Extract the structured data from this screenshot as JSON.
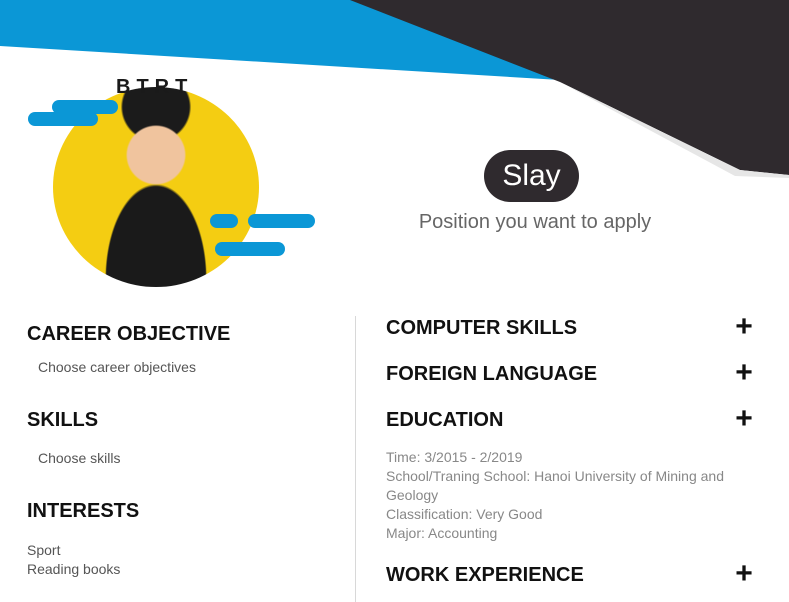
{
  "header": {
    "photo_caption": "BTRT",
    "name": "Slay",
    "position": "Position you want to apply"
  },
  "left": {
    "career_title": "CAREER OBJECTIVE",
    "career_body": "Choose career objectives",
    "skills_title": "SKILLS",
    "skills_body": "Choose skills",
    "interests_title": "INTERESTS",
    "interests": [
      "Sport",
      "Reading books"
    ]
  },
  "right": {
    "computer_title": "COMPUTER SKILLS",
    "language_title": "FOREIGN LANGUAGE",
    "education_title": "EDUCATION",
    "education_lines": [
      "Time: 3/2015 - 2/2019",
      "School/Traning School: Hanoi University of Mining and",
      "Geology",
      "Classification: Very Good",
      "Major: Accounting"
    ],
    "work_title": "WORK EXPERIENCE",
    "add_symbol": "+"
  },
  "colors": {
    "accent_blue": "#0b97d6",
    "dark": "#2f2a2e",
    "text_gray": "#666666"
  }
}
